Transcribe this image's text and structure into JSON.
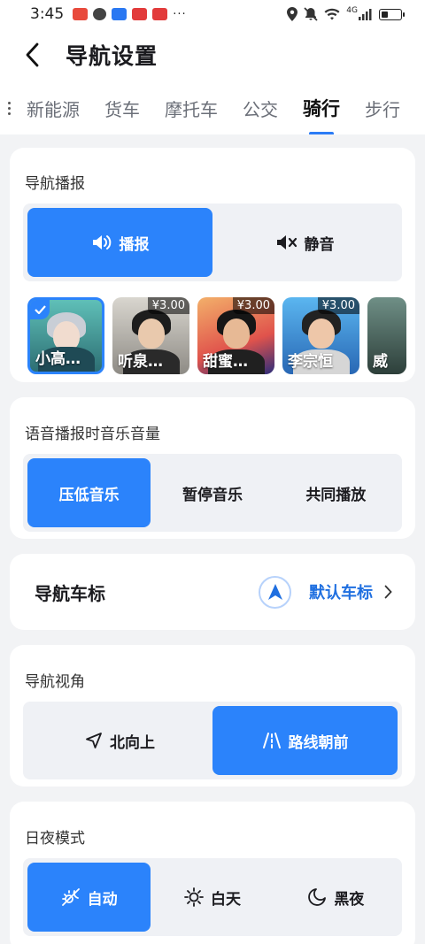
{
  "status": {
    "time": "3:45",
    "network": "4G",
    "more": "···",
    "apps": [
      {
        "name": "app-icon-1",
        "color": "#e84a3c"
      },
      {
        "name": "message-icon",
        "color": "#444444"
      },
      {
        "name": "app-icon-3",
        "color": "#2a78f2"
      },
      {
        "name": "app-icon-4",
        "color": "#e23b3b"
      },
      {
        "name": "app-icon-5",
        "color": "#e23b3b"
      }
    ]
  },
  "header": {
    "title": "导航设置"
  },
  "tabs": [
    {
      "label": "新能源",
      "active": false
    },
    {
      "label": "货车",
      "active": false
    },
    {
      "label": "摩托车",
      "active": false
    },
    {
      "label": "公交",
      "active": false
    },
    {
      "label": "骑行",
      "active": true
    },
    {
      "label": "步行",
      "active": false
    }
  ],
  "broadcast": {
    "title": "导航播报",
    "options": [
      "播报",
      "静音"
    ],
    "selected": "播报",
    "voices": [
      {
        "name": "小高…",
        "price": "",
        "selected": true
      },
      {
        "name": "听泉…",
        "price": "¥3.00",
        "selected": false
      },
      {
        "name": "甜蜜…",
        "price": "¥3.00",
        "selected": false
      },
      {
        "name": "李宗恒",
        "price": "¥3.00",
        "selected": false
      },
      {
        "name": "威",
        "price": "",
        "selected": false
      }
    ]
  },
  "music": {
    "title": "语音播报时音乐音量",
    "options": [
      "压低音乐",
      "暂停音乐",
      "共同播放"
    ],
    "selected": "压低音乐"
  },
  "car_marker": {
    "title": "导航车标",
    "value": "默认车标"
  },
  "view": {
    "title": "导航视角",
    "options": [
      "北向上",
      "路线朝前"
    ],
    "selected": "路线朝前"
  },
  "daynight": {
    "title": "日夜模式",
    "options": [
      "自动",
      "白天",
      "黑夜"
    ],
    "selected": "自动"
  },
  "colors": {
    "accent": "#2b83fb",
    "link": "#1f6fe0",
    "background": "#f2f3f5"
  }
}
